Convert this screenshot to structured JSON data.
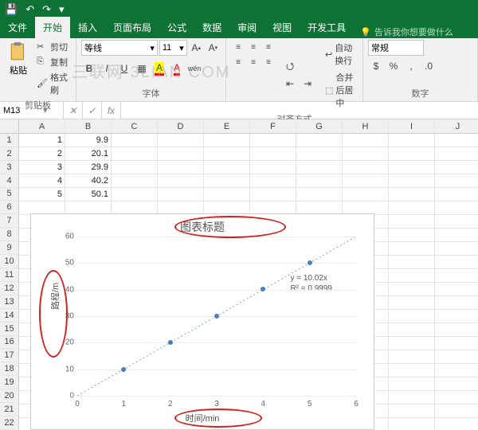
{
  "titlebar": {
    "save": "💾",
    "undo": "↶",
    "redo": "↷",
    "more": "▾"
  },
  "tabs": [
    "文件",
    "开始",
    "插入",
    "页面布局",
    "公式",
    "数据",
    "审阅",
    "视图",
    "开发工具"
  ],
  "tell_me": "告诉我你想要做什么",
  "ribbon": {
    "clipboard": {
      "paste": "粘贴",
      "cut": "剪切",
      "copy": "复制",
      "format_painter": "格式刷",
      "label": "剪贴板"
    },
    "font": {
      "name": "等线",
      "size": "11",
      "label": "字体"
    },
    "align": {
      "wrap": "自动换行",
      "merge": "合并后居中",
      "label": "对齐方式"
    },
    "number": {
      "format": "常规",
      "label": "数字"
    }
  },
  "watermark": "三联网 3LIAN COM",
  "name_box": "M13",
  "columns": [
    "A",
    "B",
    "C",
    "D",
    "E",
    "F",
    "G",
    "H",
    "I",
    "J"
  ],
  "rows": 22,
  "data": {
    "A": [
      "1",
      "2",
      "3",
      "4",
      "5"
    ],
    "B": [
      "9.9",
      "20.1",
      "29.9",
      "40.2",
      "50.1"
    ]
  },
  "chart": {
    "title": "图表标题",
    "xlabel": "时间/min",
    "ylabel": "路程/m",
    "xticks": [
      0,
      1,
      2,
      3,
      4,
      5,
      6
    ],
    "yticks": [
      0,
      10,
      20,
      30,
      40,
      50,
      60
    ],
    "trend_eq": "y = 10.02x",
    "trend_r2": "R² = 0.9999"
  },
  "chart_data": {
    "type": "scatter",
    "title": "图表标题",
    "xlabel": "时间/min",
    "ylabel": "路程/m",
    "x": [
      1,
      2,
      3,
      4,
      5
    ],
    "y": [
      9.9,
      20.1,
      29.9,
      40.2,
      50.1
    ],
    "xlim": [
      0,
      6
    ],
    "ylim": [
      0,
      60
    ],
    "trendline": {
      "slope": 10.02,
      "intercept": 0,
      "r2": 0.9999
    }
  }
}
